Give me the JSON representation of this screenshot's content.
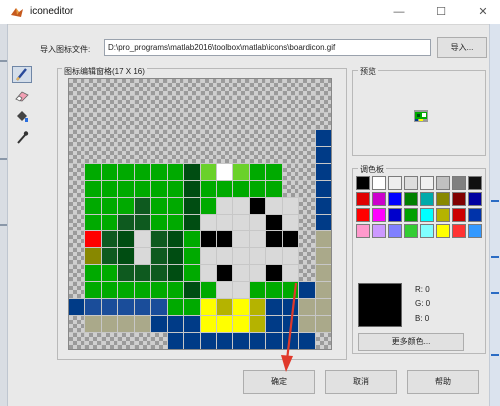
{
  "window": {
    "title": "iconeditor",
    "minimize": "—",
    "maximize": "☐",
    "close": "✕"
  },
  "file": {
    "label": "导入图标文件:",
    "path": "D:\\pro_programs\\matlab2016\\toolbox\\matlab\\icons\\boardicon.gif",
    "import_button": "导入..."
  },
  "tools": [
    {
      "name": "pencil",
      "icon": "pencil-icon",
      "selected": true
    },
    {
      "name": "eraser",
      "icon": "eraser-icon"
    },
    {
      "name": "fill",
      "icon": "paint-bucket-icon"
    },
    {
      "name": "eyedropper",
      "icon": "eyedropper-icon"
    }
  ],
  "grid_panel": {
    "title": "图标编辑窗格(17 X 16)",
    "palette_key": {
      ".": "transparent",
      "G": "#00aa00",
      "D": "#004d12",
      "d": "#0e5a1f",
      "K": "#000000",
      "W": "#ffffff",
      "L": "#d9d9d9",
      "R": "#ff0000",
      "O": "#888800",
      "N": "#003b87",
      "n": "#1a4d9a",
      "Y": "#ffff00",
      "y": "#b5b300",
      "l": "#6ad12a",
      "T": "#aaa98a",
      "B": "#11458f"
    },
    "rows": [
      "................",
      "................",
      "...............",
      "...............N",
      "...............N",
      ".GGGGGGDlWlGG..N",
      ".GGGGGGDGGGGG..N",
      ".GGGdGGDGLLKLL.N",
      ".GGddGGDLLLLKL.N",
      ".RdDLdDGKKLLKK.T",
      ".OdDLdDGLLLLLL.T",
      ".GGdddDGLKLLKL.T",
      ".GGGGGGDGLLGGGNT",
      "NnnnnnGGYyYyNNTT",
      ".TTTTNNNYYYyNNTT",
      "......NNNNNNNNN."
    ]
  },
  "preview": {
    "title": "预览",
    "icon": "board-preview-icon"
  },
  "palette": {
    "title": "调色板",
    "colors": [
      "#000000",
      "#ffffff",
      "#eeeeee",
      "#dddddd",
      "#f0f0f0",
      "#c0c0c0",
      "#808080",
      "#101010",
      "#e00000",
      "#cc00cc",
      "#0000ff",
      "#008000",
      "#00aaaa",
      "#888800",
      "#800000",
      "#0000a0",
      "#ff0000",
      "#ff00ff",
      "#0000cc",
      "#00a000",
      "#00ffff",
      "#b5b300",
      "#cc0000",
      "#0033aa",
      "#ff99cc",
      "#cc99ff",
      "#8080ff",
      "#33cc33",
      "#80ffff",
      "#ffff00",
      "#ff3333",
      "#3399ff"
    ]
  },
  "current_color": {
    "hex": "#000000",
    "r_label": "R: 0",
    "g_label": "G: 0",
    "b_label": "B: 0"
  },
  "more_colors_button": "更多颜色...",
  "buttons": {
    "ok": "确定",
    "cancel": "取消",
    "help": "帮助"
  },
  "annotation": {
    "arrow_color": "#e0392b"
  }
}
